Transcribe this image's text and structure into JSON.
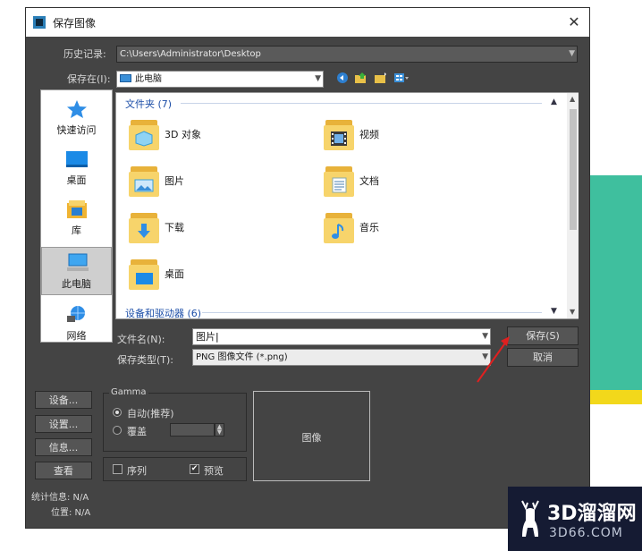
{
  "window": {
    "title": "保存图像",
    "icon": "3dsmax-app-icon",
    "close_label": "✕"
  },
  "history": {
    "label": "历史记录:",
    "value": "C:\\Users\\Administrator\\Desktop"
  },
  "save_in": {
    "label": "保存在(I):",
    "value": "此电脑",
    "toolbar_icons": [
      "back-icon",
      "up-folder-icon",
      "new-folder-icon",
      "view-menu-icon"
    ]
  },
  "sidebar": {
    "items": [
      {
        "label": "快速访问",
        "icon": "star-icon",
        "selected": false
      },
      {
        "label": "桌面",
        "icon": "desktop-icon",
        "selected": false
      },
      {
        "label": "库",
        "icon": "library-icon",
        "selected": false
      },
      {
        "label": "此电脑",
        "icon": "computer-icon",
        "selected": true
      },
      {
        "label": "网络",
        "icon": "network-icon",
        "selected": false
      }
    ]
  },
  "file_list": {
    "group1": "文件夹 (7)",
    "group2": "设备和驱动器 (6)",
    "folders": [
      {
        "name": "3D 对象",
        "icon": "3d-objects-folder-icon"
      },
      {
        "name": "视频",
        "icon": "videos-folder-icon"
      },
      {
        "name": "图片",
        "icon": "pictures-folder-icon"
      },
      {
        "name": "文档",
        "icon": "documents-folder-icon"
      },
      {
        "name": "下载",
        "icon": "downloads-folder-icon"
      },
      {
        "name": "音乐",
        "icon": "music-folder-icon"
      },
      {
        "name": "桌面",
        "icon": "desktop-folder-icon"
      }
    ]
  },
  "filename": {
    "label": "文件名(N):",
    "value": "图片"
  },
  "filetype": {
    "label": "保存类型(T):",
    "value": "PNG 图像文件 (*.png)"
  },
  "actions": {
    "save": "保存(S)",
    "cancel": "取消"
  },
  "left_buttons": {
    "setup": "设备...",
    "settings": "设置...",
    "info": "信息...",
    "view": "查看"
  },
  "gamma": {
    "title": "Gamma",
    "auto": "自动(推荐)",
    "override": "覆盖",
    "auto_selected": true
  },
  "options": {
    "sequence": "序列",
    "sequence_checked": false,
    "preview": "预览",
    "preview_checked": true
  },
  "image_preview": {
    "label": "图像"
  },
  "stats": {
    "stats_label": "统计信息: N/A",
    "position_label": "位置: N/A"
  },
  "watermark": {
    "brand": "3D溜溜网",
    "url": "3D66.COM"
  },
  "colors": {
    "dialog_bg": "#444444",
    "accent_arrow": "#e02020",
    "link_blue": "#1e4fa8"
  }
}
